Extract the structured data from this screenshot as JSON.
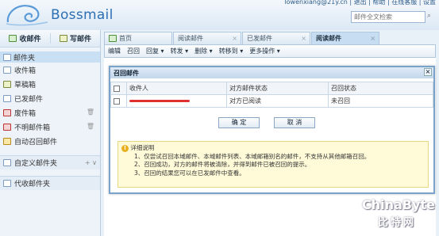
{
  "app": {
    "logo_text": "Bossmail",
    "user_links": "lowenxiang@21y.cn | 退出 | 帮助 | 在线客服 | 设置"
  },
  "search": {
    "placeholder": "邮件全文检索"
  },
  "left": {
    "receive_label": "收邮件",
    "compose_label": "写邮件",
    "folder_header": "邮件夹",
    "folders": [
      "收件箱",
      "草稿箱",
      "已发邮件",
      "废件箱",
      "不明邮件箱",
      "自动召回邮件"
    ],
    "custom_folders": "自定义邮件夹",
    "proxy_folders": "代收邮件夹"
  },
  "tabs": [
    "首页",
    "阅读邮件",
    "已发邮件",
    "阅读邮件"
  ],
  "toolbar": [
    "编辑",
    "召回",
    "回复 ▾",
    "转发 ▾",
    "删除 ▾",
    "转移到 ▾",
    "更多操作 ▾"
  ],
  "dialog": {
    "title": "召回邮件",
    "headers": [
      "收件人",
      "对方邮件状态",
      "召回状态"
    ],
    "rows": [
      {
        "recipient": "",
        "mail_status": "对方已阅读",
        "recall_status": "未召回"
      }
    ],
    "ok_label": "确  定",
    "cancel_label": "取  消",
    "info_title": "详细说明",
    "info_lines": [
      "1、仅尝试召回本域邮件、本域邮件列表、本域邮箱别名的邮件，不支持从其他邮箱召回。",
      "2、召回成功，对方的邮件将被清除，并得到邮件已被召回的提示。",
      "3、召回的结果您可以在已发邮件中查看。"
    ]
  },
  "watermark": {
    "en": "ChinaByte",
    "cn": "比特网"
  }
}
